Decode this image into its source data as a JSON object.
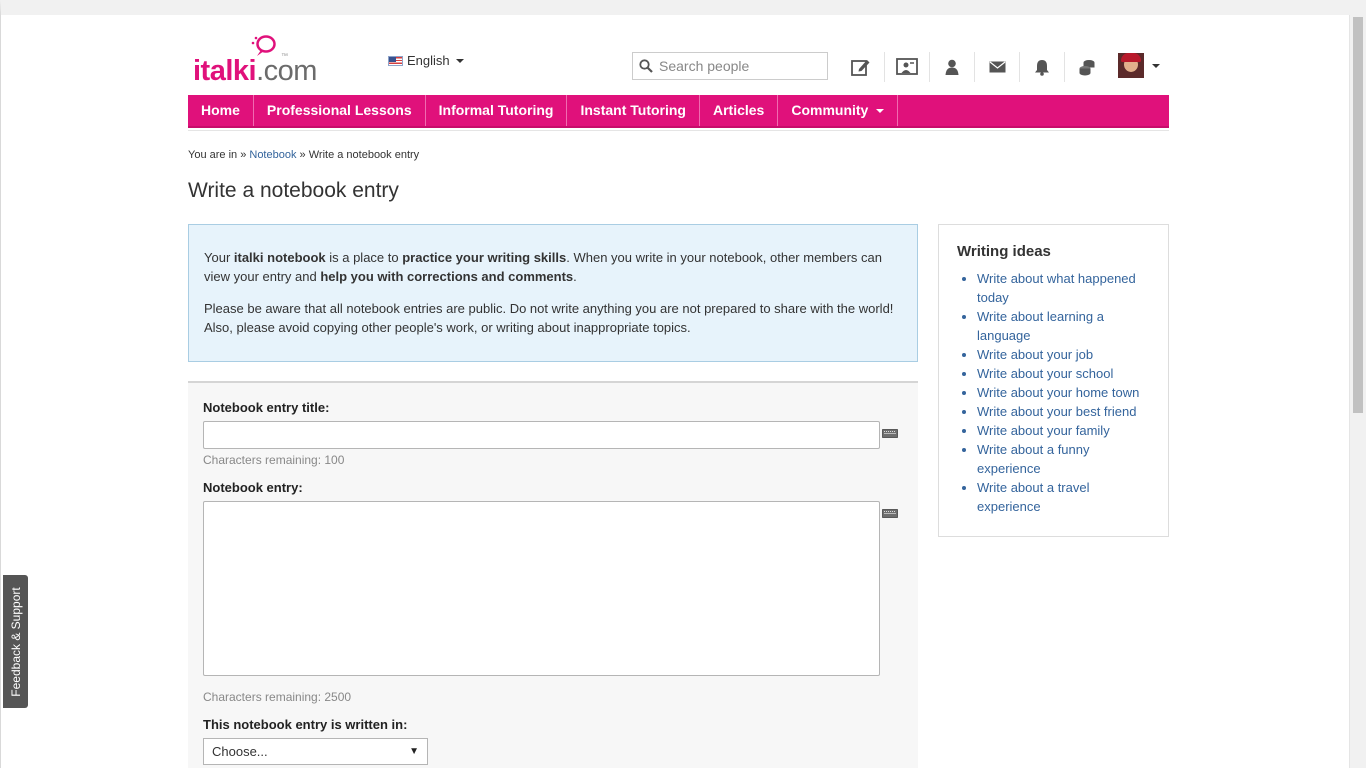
{
  "header": {
    "logo_main": "italki",
    "logo_suffix": ".com",
    "logo_tm": "™",
    "language": "English",
    "search_placeholder": "Search people",
    "icons": [
      "write-icon",
      "teacher-board-icon",
      "user-icon",
      "mail-icon",
      "bell-icon",
      "coins-icon"
    ]
  },
  "nav": {
    "items": [
      {
        "label": "Home"
      },
      {
        "label": "Professional Lessons"
      },
      {
        "label": "Informal Tutoring"
      },
      {
        "label": "Instant Tutoring"
      },
      {
        "label": "Articles"
      },
      {
        "label": "Community"
      }
    ]
  },
  "breadcrumb": {
    "prefix": "You are in »",
    "link": "Notebook",
    "sep": "»",
    "current": "Write a notebook entry"
  },
  "page_title": "Write a notebook entry",
  "info": {
    "p1_a": "Your ",
    "p1_b": "italki notebook",
    "p1_c": " is a place to ",
    "p1_d": "practice your writing skills",
    "p1_e": ". When you write in your notebook, other members can view your entry and ",
    "p1_f": "help you with corrections and comments",
    "p1_g": ".",
    "p2": "Please be aware that all notebook entries are public. Do not write anything you are not prepared to share with the world! Also, please avoid copying other people's work, or writing about inappropriate topics."
  },
  "form": {
    "title_label": "Notebook entry title:",
    "title_value": "",
    "title_remaining": "Characters remaining: 100",
    "entry_label": "Notebook entry:",
    "entry_value": "",
    "entry_remaining": "Characters remaining: 2500",
    "language_label": "This notebook entry is written in:",
    "language_selected": "Choose..."
  },
  "ideas": {
    "title": "Writing ideas",
    "items": [
      "Write about what happened today",
      "Write about learning a language",
      "Write about your job",
      "Write about your school",
      "Write about your home town",
      "Write about your best friend",
      "Write about your family",
      "Write about a funny experience",
      "Write about a travel experience"
    ]
  },
  "feedback_label": "Feedback & Support",
  "colors": {
    "brand": "#e0117b",
    "link": "#34649c",
    "info_bg": "#e7f3fb"
  }
}
